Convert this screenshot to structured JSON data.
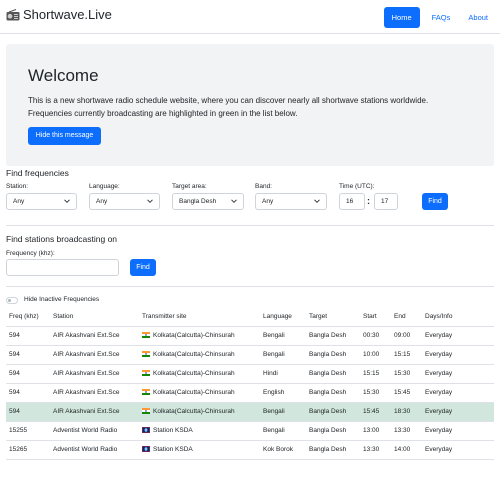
{
  "navbar": {
    "brand": "Shortwave.Live",
    "brand_icon": "radio-icon",
    "links": [
      {
        "label": "Home",
        "active": true
      },
      {
        "label": "FAQs",
        "active": false
      },
      {
        "label": "About",
        "active": false
      }
    ]
  },
  "welcome": {
    "title": "Welcome",
    "text": "This is a new shortwave radio schedule website, where you can discover nearly all shortwave stations worldwide. Frequencies currently broadcasting are highlighted in green in the list below.",
    "hide_button": "Hide this message"
  },
  "find_frequencies": {
    "title": "Find frequencies",
    "station_label": "Station:",
    "station_value": "Any",
    "language_label": "Language:",
    "language_value": "Any",
    "target_label": "Target area:",
    "target_value": "Bangla Desh",
    "band_label": "Band:",
    "band_value": "Any",
    "time_label": "Time (UTC):",
    "time_hour": "16",
    "time_sep": ":",
    "time_minute": "17",
    "find_button": "Find"
  },
  "find_stations": {
    "title": "Find stations broadcasting on",
    "frequency_label": "Frequency (khz):",
    "frequency_value": "",
    "find_button": "Find"
  },
  "hide_inactive": {
    "label": "Hide Inactive Frequencies",
    "checked": false
  },
  "table": {
    "headers": [
      "Freq (khz)",
      "Station",
      "Transmitter site",
      "Language",
      "Target",
      "Start",
      "End",
      "Days/Info"
    ],
    "rows": [
      {
        "freq": "594",
        "station": "AIR Akashvani Ext.Sce",
        "flag": "india-flag",
        "site": "Kolkata(Calcutta)-Chinsurah",
        "language": "Bengali",
        "target": "Bangla Desh",
        "start": "00:30",
        "end": "09:00",
        "days": "Everyday",
        "active": false
      },
      {
        "freq": "594",
        "station": "AIR Akashvani Ext.Sce",
        "flag": "india-flag",
        "site": "Kolkata(Calcutta)-Chinsurah",
        "language": "Bengali",
        "target": "Bangla Desh",
        "start": "10:00",
        "end": "15:15",
        "days": "Everyday",
        "active": false
      },
      {
        "freq": "594",
        "station": "AIR Akashvani Ext.Sce",
        "flag": "india-flag",
        "site": "Kolkata(Calcutta)-Chinsurah",
        "language": "Hindi",
        "target": "Bangla Desh",
        "start": "15:15",
        "end": "15:30",
        "days": "Everyday",
        "active": false
      },
      {
        "freq": "594",
        "station": "AIR Akashvani Ext.Sce",
        "flag": "india-flag",
        "site": "Kolkata(Calcutta)-Chinsurah",
        "language": "English",
        "target": "Bangla Desh",
        "start": "15:30",
        "end": "15:45",
        "days": "Everyday",
        "active": false
      },
      {
        "freq": "594",
        "station": "AIR Akashvani Ext.Sce",
        "flag": "india-flag",
        "site": "Kolkata(Calcutta)-Chinsurah",
        "language": "Bengali",
        "target": "Bangla Desh",
        "start": "15:45",
        "end": "18:30",
        "days": "Everyday",
        "active": true
      },
      {
        "freq": "15255",
        "station": "Adventist World Radio",
        "flag": "guam-flag",
        "site": "Station KSDA",
        "language": "Bengali",
        "target": "Bangla Desh",
        "start": "13:00",
        "end": "13:30",
        "days": "Everyday",
        "active": false
      },
      {
        "freq": "15265",
        "station": "Adventist World Radio",
        "flag": "guam-flag",
        "site": "Station KSDA",
        "language": "Kok Borok",
        "target": "Bangla Desh",
        "start": "13:30",
        "end": "14:00",
        "days": "Everyday",
        "active": false
      }
    ]
  },
  "colors": {
    "primary": "#0d6efd",
    "active_row": "#d1e7dd",
    "jumbotron_bg": "#f1f3f5"
  }
}
